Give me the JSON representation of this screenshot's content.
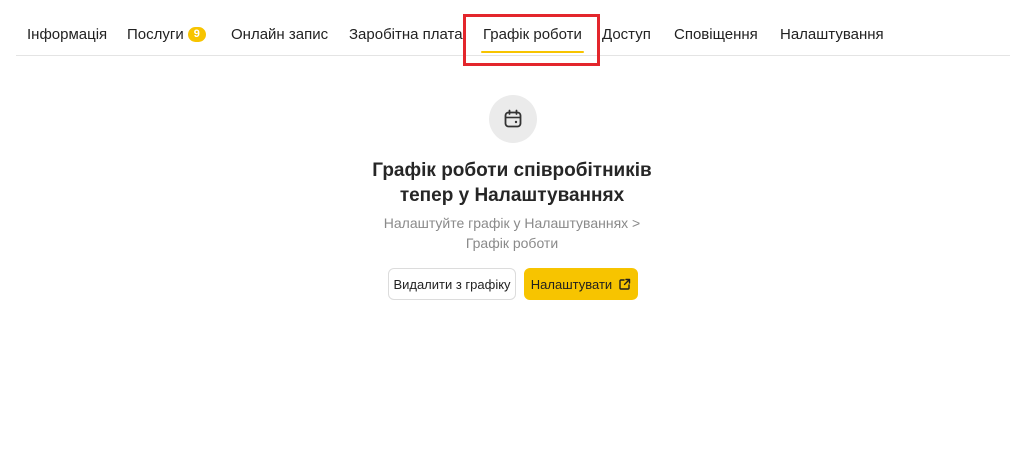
{
  "tabs": [
    {
      "label": "Інформація"
    },
    {
      "label": "Послуги",
      "badge": "9"
    },
    {
      "label": "Онлайн запис"
    },
    {
      "label": "Заробітна плата"
    },
    {
      "label": "Графік роботи",
      "active": true
    },
    {
      "label": "Доступ"
    },
    {
      "label": "Сповіщення"
    },
    {
      "label": "Налаштування"
    }
  ],
  "empty_state": {
    "icon": "calendar-icon",
    "title_line1": "Графік роботи співробітників",
    "title_line2": "тепер у Налаштуваннях",
    "subtitle_line1": "Налаштуйте графік у Налаштуваннях >",
    "subtitle_line2": "Графік роботи",
    "remove_button": "Видалити з графіку",
    "configure_button": "Налаштувати",
    "configure_icon": "external-link-icon"
  },
  "colors": {
    "accent": "#f7c400",
    "highlight": "#e3262c",
    "muted_text": "#8a8a8a",
    "icon_bg": "#ebebeb"
  }
}
